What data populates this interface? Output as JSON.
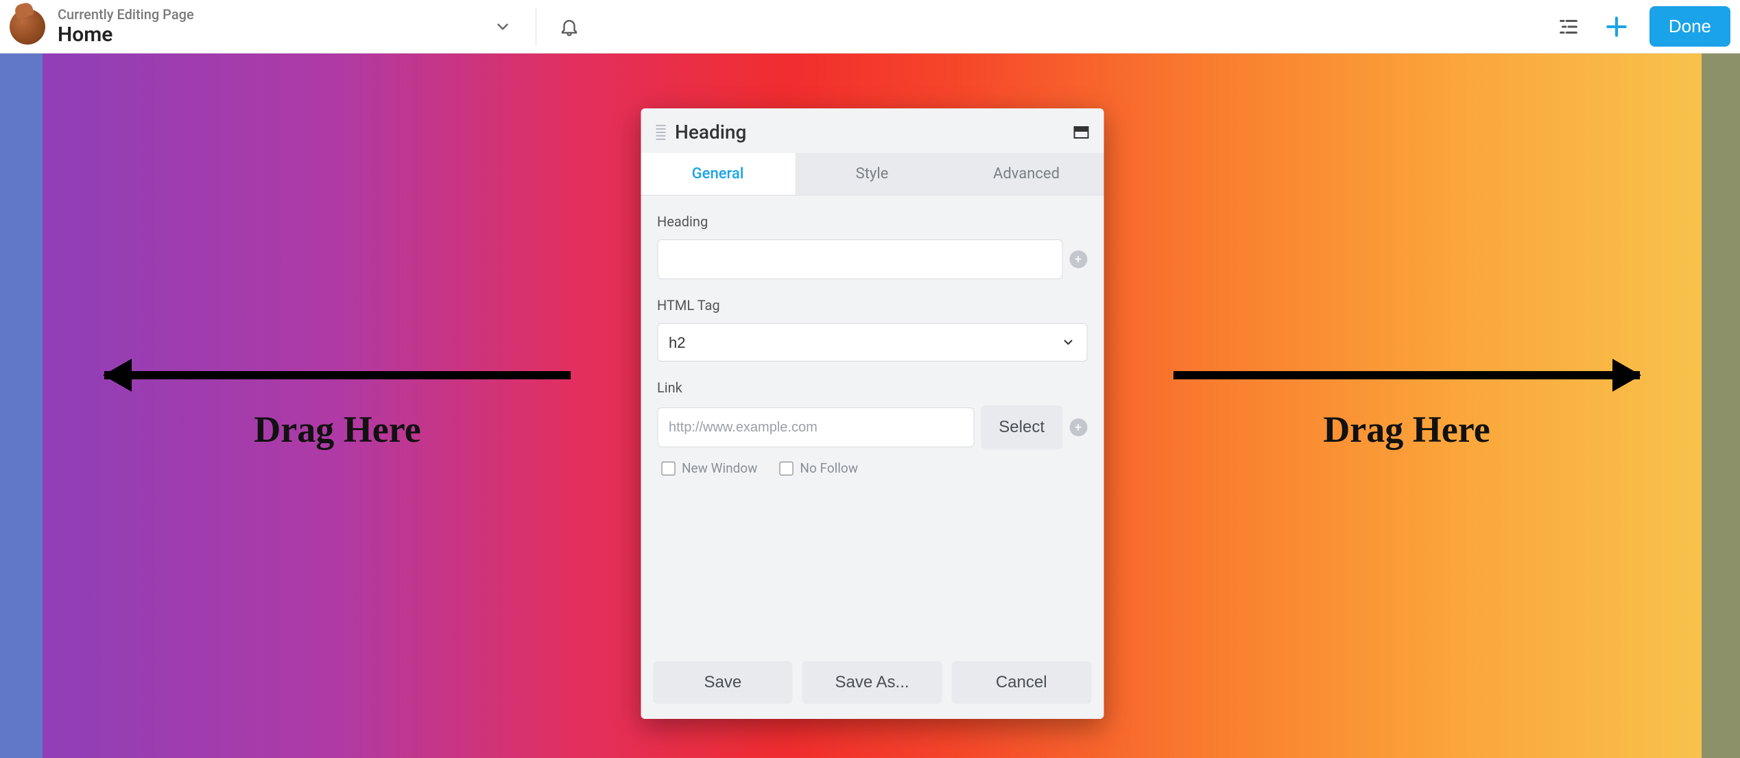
{
  "header": {
    "subtitle": "Currently Editing Page",
    "title": "Home",
    "done_label": "Done"
  },
  "canvas": {
    "drag_left": "Drag Here",
    "drag_right": "Drag Here"
  },
  "panel": {
    "title": "Heading",
    "tabs": {
      "general": "General",
      "style": "Style",
      "advanced": "Advanced"
    },
    "fields": {
      "heading_label": "Heading",
      "heading_value": "",
      "htmltag_label": "HTML Tag",
      "htmltag_value": "h2",
      "link_label": "Link",
      "link_placeholder": "http://www.example.com",
      "link_value": "",
      "select_label": "Select",
      "new_window": "New Window",
      "no_follow": "No Follow"
    },
    "buttons": {
      "save": "Save",
      "save_as": "Save As...",
      "cancel": "Cancel"
    }
  }
}
